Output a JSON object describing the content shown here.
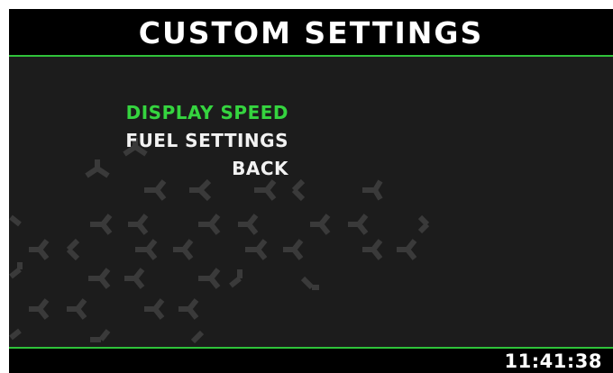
{
  "screen": {
    "title": "CUSTOM SETTINGS"
  },
  "menu": {
    "items": [
      {
        "label": "DISPLAY SPEED",
        "selected": true
      },
      {
        "label": "FUEL SETTINGS",
        "selected": false
      },
      {
        "label": "BACK",
        "selected": false
      }
    ]
  },
  "footer": {
    "clock": "11:41:38"
  },
  "colors": {
    "accent": "#2fc23a",
    "selected_text": "#35d43f",
    "text": "#f2f2f2",
    "background": "#1c1c1c",
    "bar": "#000000"
  },
  "icons": {
    "background_pattern": "hexagon-pattern-icon"
  }
}
